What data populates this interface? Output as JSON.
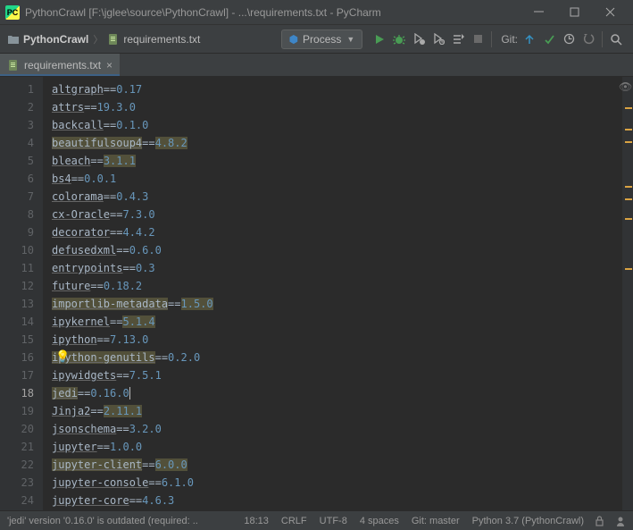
{
  "titlebar": {
    "app_badge": "PC",
    "title": "PythonCrawl [F:\\jglee\\source\\PythonCrawl] - ...\\requirements.txt - PyCharm"
  },
  "breadcrumb": {
    "project": "PythonCrawl",
    "file": "requirements.txt"
  },
  "run_config": {
    "label": "Process"
  },
  "git_label": "Git:",
  "editor_tab": {
    "label": "requirements.txt"
  },
  "requirements": [
    {
      "pkg": "altgraph",
      "ver": "0.17",
      "hl_pkg": false,
      "hl_ver": false
    },
    {
      "pkg": "attrs",
      "ver": "19.3.0",
      "hl_pkg": false,
      "hl_ver": false
    },
    {
      "pkg": "backcall",
      "ver": "0.1.0",
      "hl_pkg": false,
      "hl_ver": false
    },
    {
      "pkg": "beautifulsoup4",
      "ver": "4.8.2",
      "hl_pkg": true,
      "hl_ver": true
    },
    {
      "pkg": "bleach",
      "ver": "3.1.1",
      "hl_pkg": false,
      "hl_ver": true
    },
    {
      "pkg": "bs4",
      "ver": "0.0.1",
      "hl_pkg": false,
      "hl_ver": false
    },
    {
      "pkg": "colorama",
      "ver": "0.4.3",
      "hl_pkg": false,
      "hl_ver": false
    },
    {
      "pkg": "cx-Oracle",
      "ver": "7.3.0",
      "hl_pkg": false,
      "hl_ver": false
    },
    {
      "pkg": "decorator",
      "ver": "4.4.2",
      "hl_pkg": false,
      "hl_ver": false
    },
    {
      "pkg": "defusedxml",
      "ver": "0.6.0",
      "hl_pkg": false,
      "hl_ver": false
    },
    {
      "pkg": "entrypoints",
      "ver": "0.3",
      "hl_pkg": false,
      "hl_ver": false
    },
    {
      "pkg": "future",
      "ver": "0.18.2",
      "hl_pkg": false,
      "hl_ver": false
    },
    {
      "pkg": "importlib-metadata",
      "ver": "1.5.0",
      "hl_pkg": true,
      "hl_ver": true
    },
    {
      "pkg": "ipykernel",
      "ver": "5.1.4",
      "hl_pkg": false,
      "hl_ver": true
    },
    {
      "pkg": "ipython",
      "ver": "7.13.0",
      "hl_pkg": false,
      "hl_ver": false
    },
    {
      "pkg": "ipython-genutils",
      "ver": "0.2.0",
      "hl_pkg": true,
      "hl_ver": false
    },
    {
      "pkg": "ipywidgets",
      "ver": "7.5.1",
      "hl_pkg": false,
      "hl_ver": false
    },
    {
      "pkg": "jedi",
      "ver": "0.16.0",
      "hl_pkg": true,
      "hl_ver": false,
      "caret": true
    },
    {
      "pkg": "Jinja2",
      "ver": "2.11.1",
      "hl_pkg": false,
      "hl_ver": true
    },
    {
      "pkg": "jsonschema",
      "ver": "3.2.0",
      "hl_pkg": false,
      "hl_ver": false
    },
    {
      "pkg": "jupyter",
      "ver": "1.0.0",
      "hl_pkg": false,
      "hl_ver": false
    },
    {
      "pkg": "jupyter-client",
      "ver": "6.0.0",
      "hl_pkg": true,
      "hl_ver": true
    },
    {
      "pkg": "jupyter-console",
      "ver": "6.1.0",
      "hl_pkg": false,
      "hl_ver": false
    },
    {
      "pkg": "jupyter-core",
      "ver": "4.6.3",
      "hl_pkg": false,
      "hl_ver": false
    }
  ],
  "right_marks": [
    34,
    58,
    72,
    122,
    136,
    158,
    214
  ],
  "status": {
    "msg": "'jedi' version '0.16.0' is outdated (required: ..",
    "linecol": "18:13",
    "lineend": "CRLF",
    "encoding": "UTF-8",
    "indent": "4 spaces",
    "branch": "Git: master",
    "python": "Python 3.7 (PythonCrawl)"
  }
}
